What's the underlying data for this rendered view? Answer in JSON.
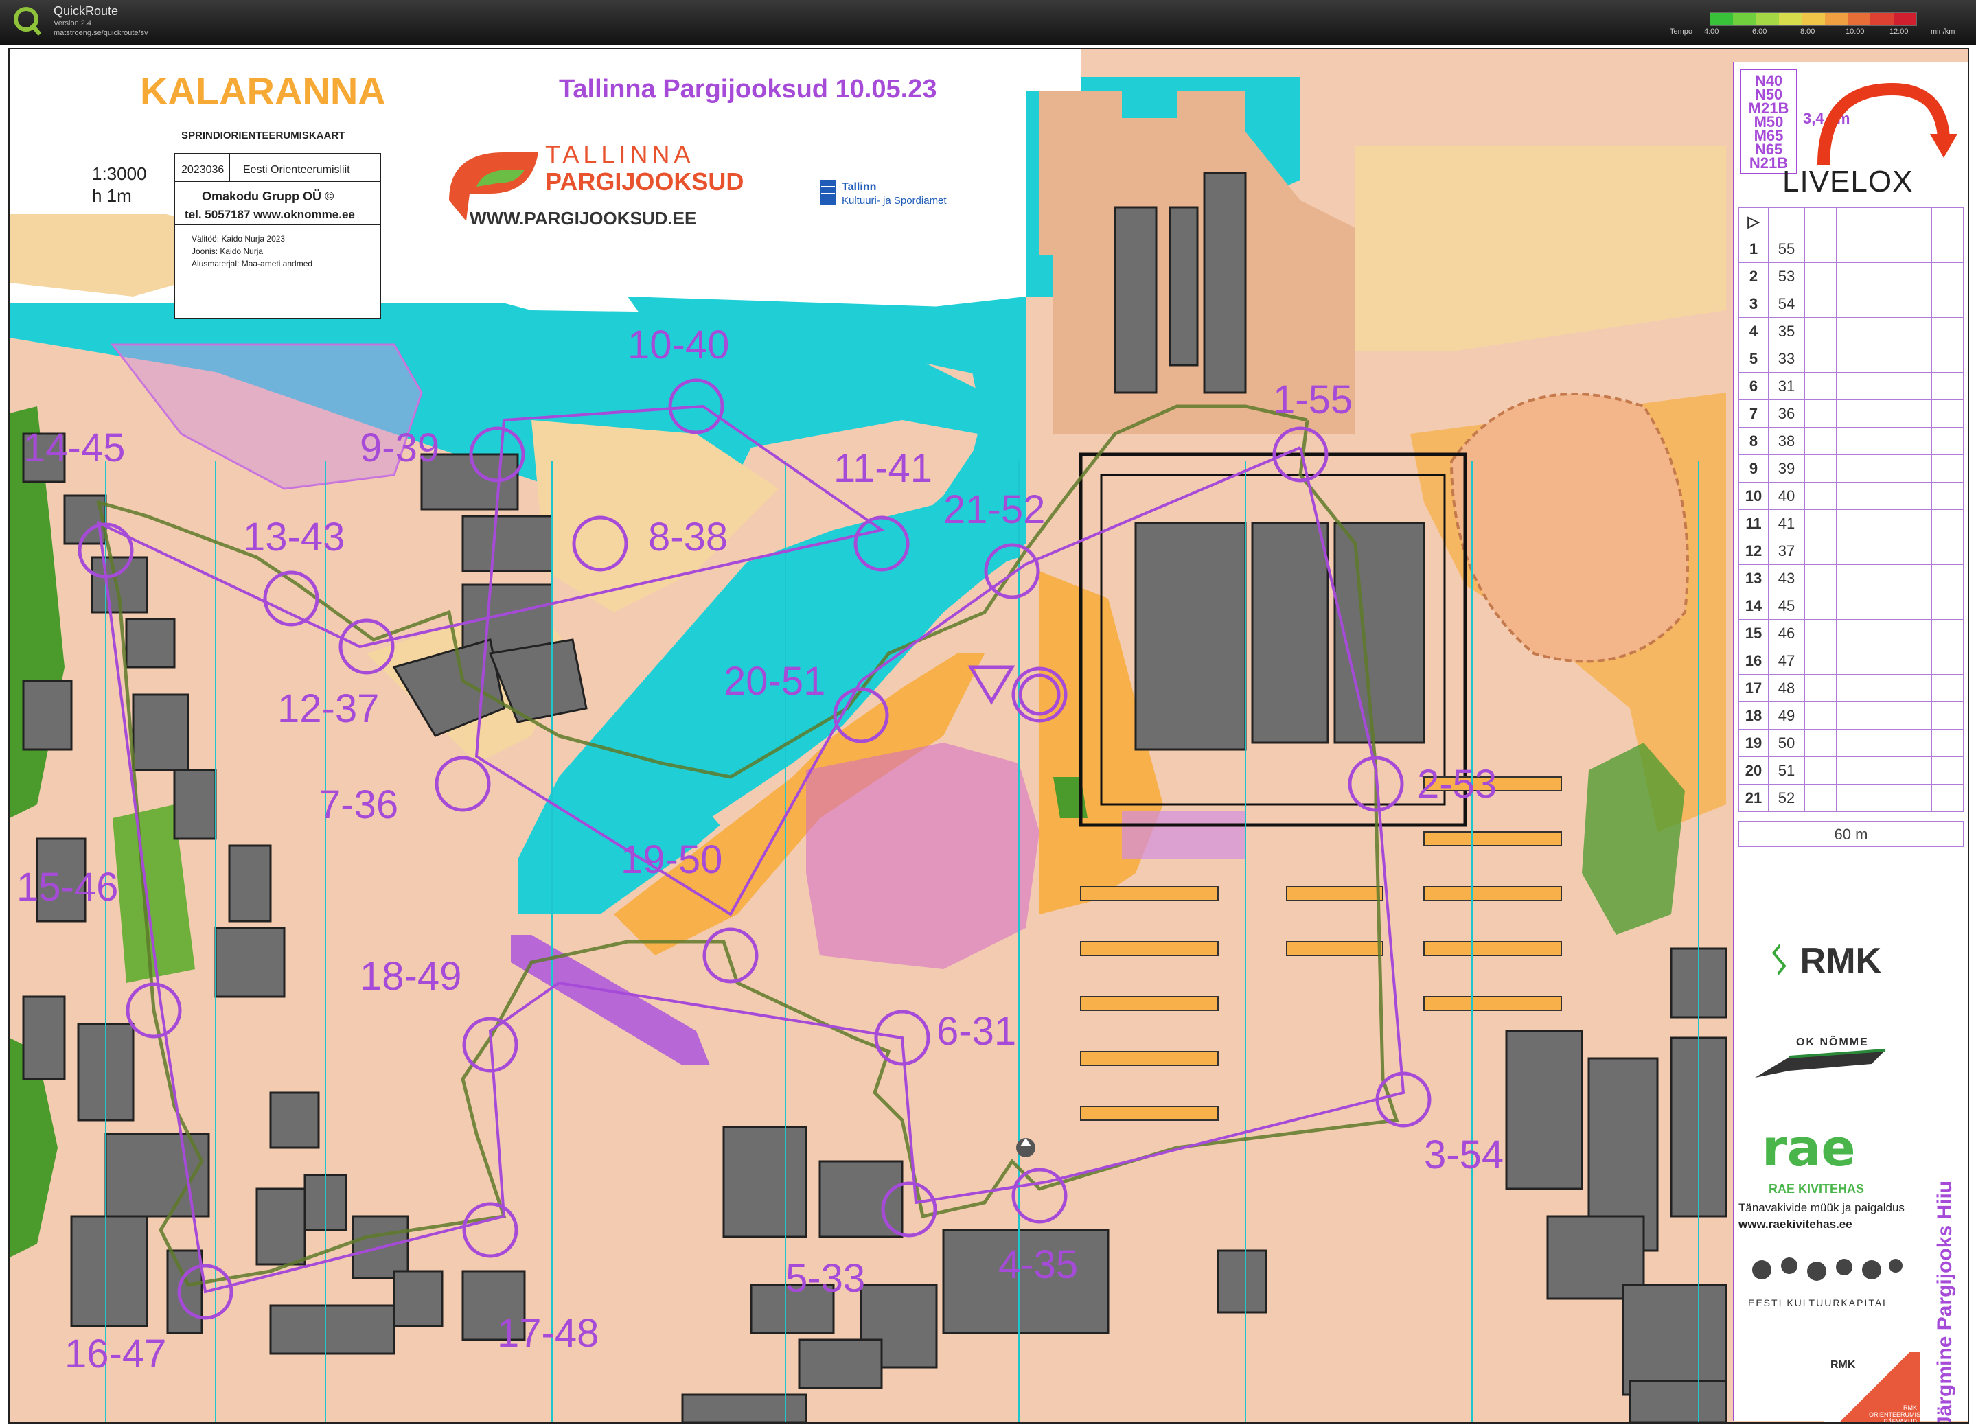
{
  "app": {
    "name": "QuickRoute",
    "version": "Version 2.4",
    "url": "matstroeng.se/quickroute/sv"
  },
  "tempo": {
    "label": "Tempo",
    "ticks": [
      "4:00",
      "6:00",
      "8:00",
      "10:00",
      "12:00",
      "min/km"
    ]
  },
  "map": {
    "name": "KALARANNA",
    "subtitle": "SPRINDIORIENTEERUMISKAART",
    "scale": "1:3000",
    "contour": "h 1m",
    "code": "2023036",
    "federation": "Eesti Orienteerumisliit",
    "maker": "Omakodu Grupp OÜ ©",
    "phone": "tel. 5057187 www.oknomme.ee",
    "credit1": "Välitöö: Kaido Nurja 2023",
    "credit2": "Joonis:  Kaido Nurja",
    "credit3": "Alusmaterjal: Maa-ameti andmed",
    "event": "Tallinna Pargijooksud 10.05.23",
    "brand_top": "TALLINNA",
    "brand_bottom": "PARGIJOOKSUD",
    "website": "WWW.PARGIJOOKSUD.EE",
    "city_top": "Tallinn",
    "city_bottom": "Kultuuri- ja Spordiamet"
  },
  "controls": [
    {
      "label": "1-55"
    },
    {
      "label": "2-53"
    },
    {
      "label": "3-54"
    },
    {
      "label": "4-35"
    },
    {
      "label": "5-33"
    },
    {
      "label": "6-31"
    },
    {
      "label": "7-36"
    },
    {
      "label": "8-38"
    },
    {
      "label": "9-39"
    },
    {
      "label": "10-40"
    },
    {
      "label": "11-41"
    },
    {
      "label": "12-37"
    },
    {
      "label": "13-43"
    },
    {
      "label": "14-45"
    },
    {
      "label": "15-46"
    },
    {
      "label": "16-47"
    },
    {
      "label": "17-48"
    },
    {
      "label": "18-49"
    },
    {
      "label": "19-50"
    },
    {
      "label": "20-51"
    },
    {
      "label": "21-52"
    }
  ],
  "course": {
    "classes": [
      "N40",
      "N50",
      "M21B",
      "M50",
      "M65",
      "N65",
      "N21B"
    ],
    "length": "3,4 km",
    "livelox": "LIVELOX",
    "finish_distance": "60 m",
    "descriptions": [
      {
        "n": "1",
        "code": "55"
      },
      {
        "n": "2",
        "code": "53"
      },
      {
        "n": "3",
        "code": "54"
      },
      {
        "n": "4",
        "code": "35"
      },
      {
        "n": "5",
        "code": "33"
      },
      {
        "n": "6",
        "code": "31"
      },
      {
        "n": "7",
        "code": "36"
      },
      {
        "n": "8",
        "code": "38"
      },
      {
        "n": "9",
        "code": "39"
      },
      {
        "n": "10",
        "code": "40"
      },
      {
        "n": "11",
        "code": "41"
      },
      {
        "n": "12",
        "code": "37"
      },
      {
        "n": "13",
        "code": "43"
      },
      {
        "n": "14",
        "code": "45"
      },
      {
        "n": "15",
        "code": "46"
      },
      {
        "n": "16",
        "code": "47"
      },
      {
        "n": "17",
        "code": "48"
      },
      {
        "n": "18",
        "code": "49"
      },
      {
        "n": "19",
        "code": "50"
      },
      {
        "n": "20",
        "code": "51"
      },
      {
        "n": "21",
        "code": "52"
      }
    ]
  },
  "sponsors": {
    "rmk": "RMK",
    "oknomme": "OK NÕMME",
    "rae": "rae",
    "rae_sub": "RAE KIVITEHAS",
    "rae_text1": "Tänavakivide müük ja paigaldus",
    "rae_text2": "www.raekivitehas.ee",
    "kultuurkapital": "EESTI KULTUURKAPITAL",
    "rmk_small": "RMK",
    "rmk_day": "RMK ORIENTEERUMIS PÄEVAKUD",
    "next_event": "Järgmine Pargijooks Hiiu"
  },
  "colors": {
    "water": "#20cfd6",
    "course": "#a64bd8",
    "building": "#6e6e6e",
    "paved": "#f3cbb0",
    "open": "#f7b04a",
    "green": "#4a9a2c",
    "route": "#5e7a2a"
  }
}
